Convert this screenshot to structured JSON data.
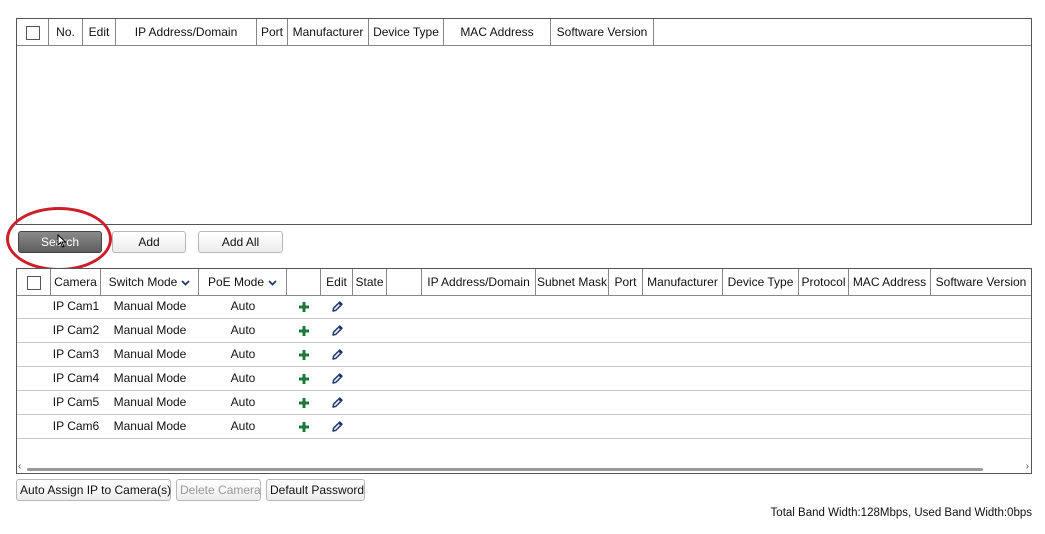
{
  "search_table": {
    "headers": [
      "No.",
      "Edit",
      "IP Address/Domain",
      "Port",
      "Manufacturer",
      "Device Type",
      "MAC Address",
      "Software Version"
    ]
  },
  "actions": {
    "search": "Search",
    "add": "Add",
    "add_all": "Add All"
  },
  "camera_table": {
    "headers": [
      "Camera",
      "Switch Mode",
      "PoE Mode",
      "",
      "Edit",
      "State",
      "",
      "IP Address/Domain",
      "Subnet Mask",
      "Port",
      "Manufacturer",
      "Device Type",
      "Protocol",
      "MAC Address",
      "Software Version"
    ],
    "rows": [
      {
        "camera": "IP Cam1",
        "switch_mode": "Manual Mode",
        "poe_mode": "Auto"
      },
      {
        "camera": "IP Cam2",
        "switch_mode": "Manual Mode",
        "poe_mode": "Auto"
      },
      {
        "camera": "IP Cam3",
        "switch_mode": "Manual Mode",
        "poe_mode": "Auto"
      },
      {
        "camera": "IP Cam4",
        "switch_mode": "Manual Mode",
        "poe_mode": "Auto"
      },
      {
        "camera": "IP Cam5",
        "switch_mode": "Manual Mode",
        "poe_mode": "Auto"
      },
      {
        "camera": "IP Cam6",
        "switch_mode": "Manual Mode",
        "poe_mode": "Auto"
      }
    ]
  },
  "bottom_actions": {
    "auto_assign": "Auto Assign IP to Camera(s)",
    "delete_camera": "Delete Camera",
    "default_password": "Default Password"
  },
  "status": {
    "bandwidth": "Total Band Width:128Mbps, Used Band Width:0bps"
  },
  "colors": {
    "add_icon": "#1f7a3a",
    "edit_icon": "#1e3a6e",
    "highlight_circle": "#cc1f2a"
  }
}
